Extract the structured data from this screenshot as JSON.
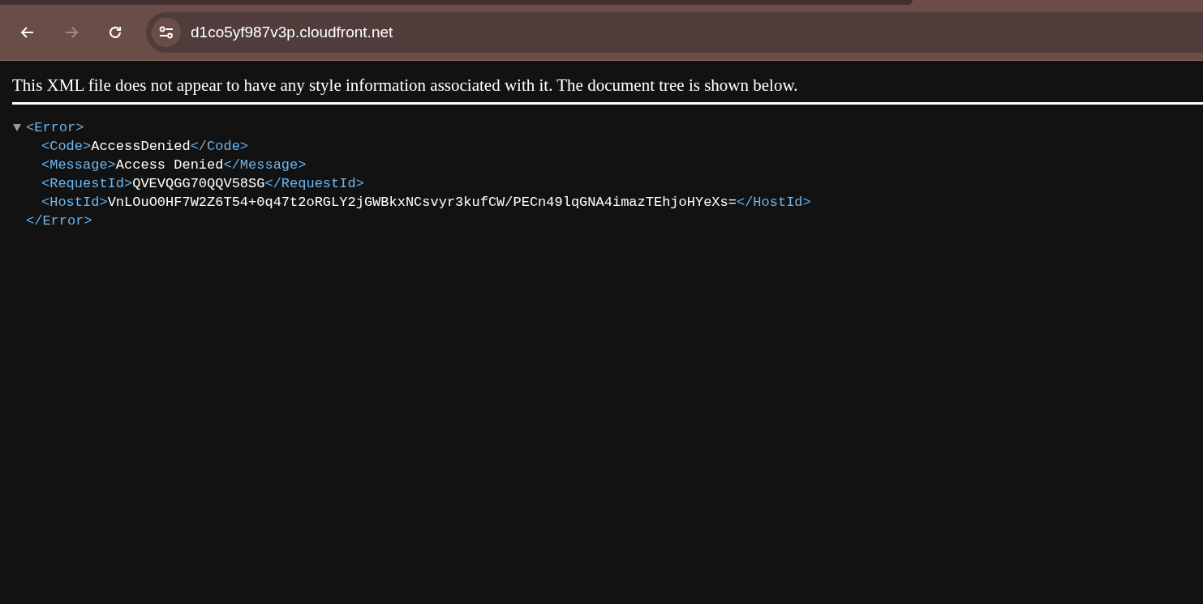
{
  "browser": {
    "address": "d1co5yf987v3p.cloudfront.net",
    "forward_disabled": true
  },
  "notice": "This XML file does not appear to have any style information associated with it. The document tree is shown below.",
  "tree": {
    "open_tag": "<Error>",
    "close_tag": "</Error>",
    "expanded": true,
    "children": [
      {
        "open_tag": "<Code>",
        "text": "AccessDenied",
        "close_tag": "</Code>"
      },
      {
        "open_tag": "<Message>",
        "text": "Access Denied",
        "close_tag": "</Message>"
      },
      {
        "open_tag": "<RequestId>",
        "text": "QVEVQGG70QQV58SG",
        "close_tag": "</RequestId>"
      },
      {
        "open_tag": "<HostId>",
        "text": "VnLOuO0HF7W2Z6T54+0q47t2oRGLY2jGWBkxNCsvyr3kufCW/PECn49lqGNA4imazTEhjoHYeXs=",
        "close_tag": "</HostId>"
      }
    ]
  }
}
